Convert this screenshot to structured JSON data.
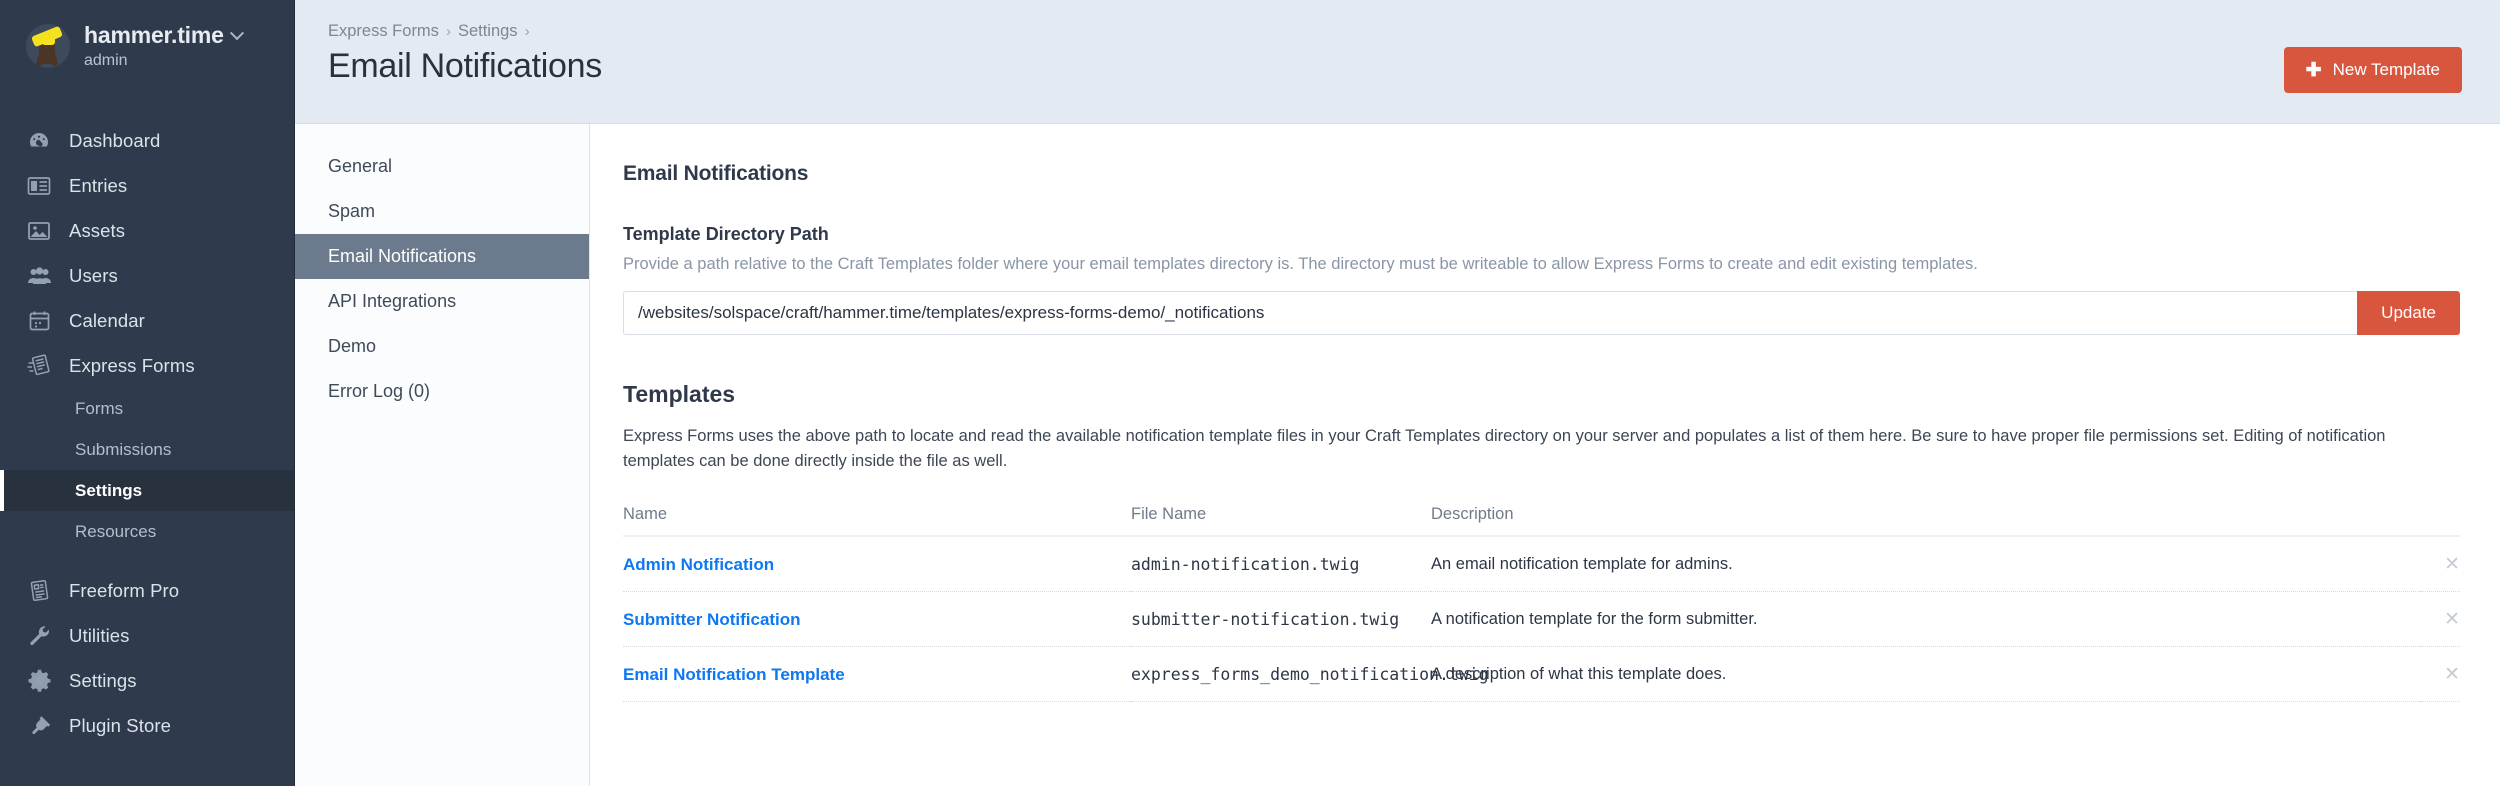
{
  "account": {
    "name": "hammer.time",
    "role": "admin",
    "avatar_icon": "hammer-avatar",
    "chevron_icon": "chevron-down-icon"
  },
  "sidebar": {
    "items": [
      {
        "label": "Dashboard",
        "icon": "gauge-icon",
        "name": "dashboard"
      },
      {
        "label": "Entries",
        "icon": "newspaper-icon",
        "name": "entries"
      },
      {
        "label": "Assets",
        "icon": "image-icon",
        "name": "assets"
      },
      {
        "label": "Users",
        "icon": "users-icon",
        "name": "users"
      },
      {
        "label": "Calendar",
        "icon": "calendar-icon",
        "name": "calendar"
      },
      {
        "label": "Express Forms",
        "icon": "express-forms-icon",
        "name": "express-forms"
      }
    ],
    "subitems": [
      {
        "label": "Forms",
        "name": "forms",
        "selected": false
      },
      {
        "label": "Submissions",
        "name": "submissions",
        "selected": false
      },
      {
        "label": "Settings",
        "name": "settings",
        "selected": true
      },
      {
        "label": "Resources",
        "name": "resources",
        "selected": false
      }
    ],
    "items_lower": [
      {
        "label": "Freeform Pro",
        "icon": "document-list-icon",
        "name": "freeform-pro"
      },
      {
        "label": "Utilities",
        "icon": "wrench-icon",
        "name": "utilities"
      },
      {
        "label": "Settings",
        "icon": "gear-icon",
        "name": "settings-global"
      },
      {
        "label": "Plugin Store",
        "icon": "plug-icon",
        "name": "plugin-store"
      }
    ]
  },
  "topbar": {
    "breadcrumb": [
      "Express Forms",
      "Settings"
    ],
    "separator": "›",
    "title": "Email Notifications",
    "new_template_label": "New Template",
    "new_template_icon": "plus-icon",
    "accent_color": "#d9563e"
  },
  "subpanel": {
    "links": [
      {
        "label": "General",
        "name": "general",
        "active": false
      },
      {
        "label": "Spam",
        "name": "spam",
        "active": false
      },
      {
        "label": "Email Notifications",
        "name": "email-notifications",
        "active": true
      },
      {
        "label": "API Integrations",
        "name": "api-integrations",
        "active": false
      },
      {
        "label": "Demo",
        "name": "demo",
        "active": false
      },
      {
        "label": "Error Log (0)",
        "name": "error-log",
        "active": false
      }
    ],
    "active_bg": "#6b7a8d"
  },
  "content": {
    "heading": "Email Notifications",
    "template_path": {
      "label": "Template Directory Path",
      "help": "Provide a path relative to the Craft Templates folder where your email templates directory is. The directory must be writeable to allow Express Forms to create and edit existing templates.",
      "value": "/websites/solspace/craft/hammer.time/templates/express-forms-demo/_notifications",
      "placeholder": "",
      "update_label": "Update"
    },
    "templates": {
      "heading": "Templates",
      "description": "Express Forms uses the above path to locate and read the available notification template files in your Craft Templates directory on your server and populates a list of them here. Be sure to have proper file permissions set. Editing of notification templates can be done directly inside the file as well.",
      "columns": [
        "Name",
        "File Name",
        "Description"
      ],
      "delete_icon": "close-icon",
      "rows": [
        {
          "name": "Admin Notification",
          "file": "admin-notification.twig",
          "description": "An email notification template for admins."
        },
        {
          "name": "Submitter Notification",
          "file": "submitter-notification.twig",
          "description": "A notification template for the form submitter."
        },
        {
          "name": "Email Notification Template",
          "file": "express_forms_demo_notification.twig",
          "description": "A description of what this template does."
        }
      ]
    }
  }
}
